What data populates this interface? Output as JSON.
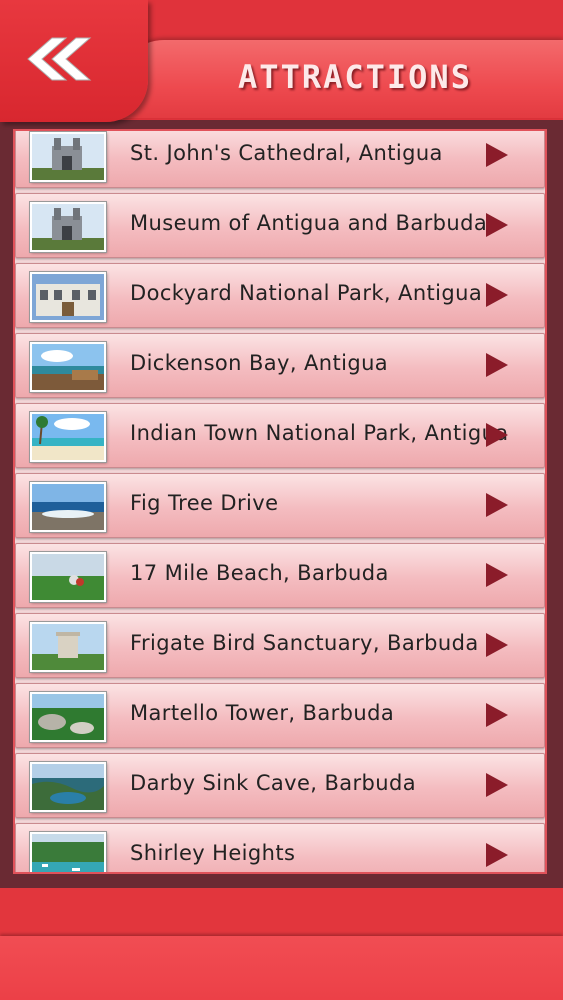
{
  "header": {
    "title": "ATTRACTIONS",
    "back_icon": "double-chevron-left-icon"
  },
  "colors": {
    "header_red": "#e0333b",
    "title_band": "#ee4a4f",
    "list_background": "#6a2a33",
    "row_gradient_top": "#fbe3e4",
    "row_gradient_bottom": "#eea9ad",
    "chevron": "#8b1c2a",
    "title_text": "#fde9e9"
  },
  "attractions": [
    {
      "label": "St. John's Cathedral, Antigua",
      "thumbnail": "cathedral"
    },
    {
      "label": "Museum of Antigua and Barbuda",
      "thumbnail": "cathedral"
    },
    {
      "label": "Dockyard National Park, Antigua",
      "thumbnail": "building"
    },
    {
      "label": "Dickenson Bay, Antigua",
      "thumbnail": "coast"
    },
    {
      "label": "Indian Town National Park, Antigua",
      "thumbnail": "beach"
    },
    {
      "label": "Fig Tree Drive",
      "thumbnail": "shore"
    },
    {
      "label": "17 Mile Beach, Barbuda",
      "thumbnail": "greenery"
    },
    {
      "label": "Frigate Bird Sanctuary, Barbuda",
      "thumbnail": "tower"
    },
    {
      "label": "Martello Tower, Barbuda",
      "thumbnail": "rocks"
    },
    {
      "label": "Darby Sink Cave, Barbuda",
      "thumbnail": "bay"
    },
    {
      "label": "Shirley Heights",
      "thumbnail": "harbor"
    }
  ]
}
